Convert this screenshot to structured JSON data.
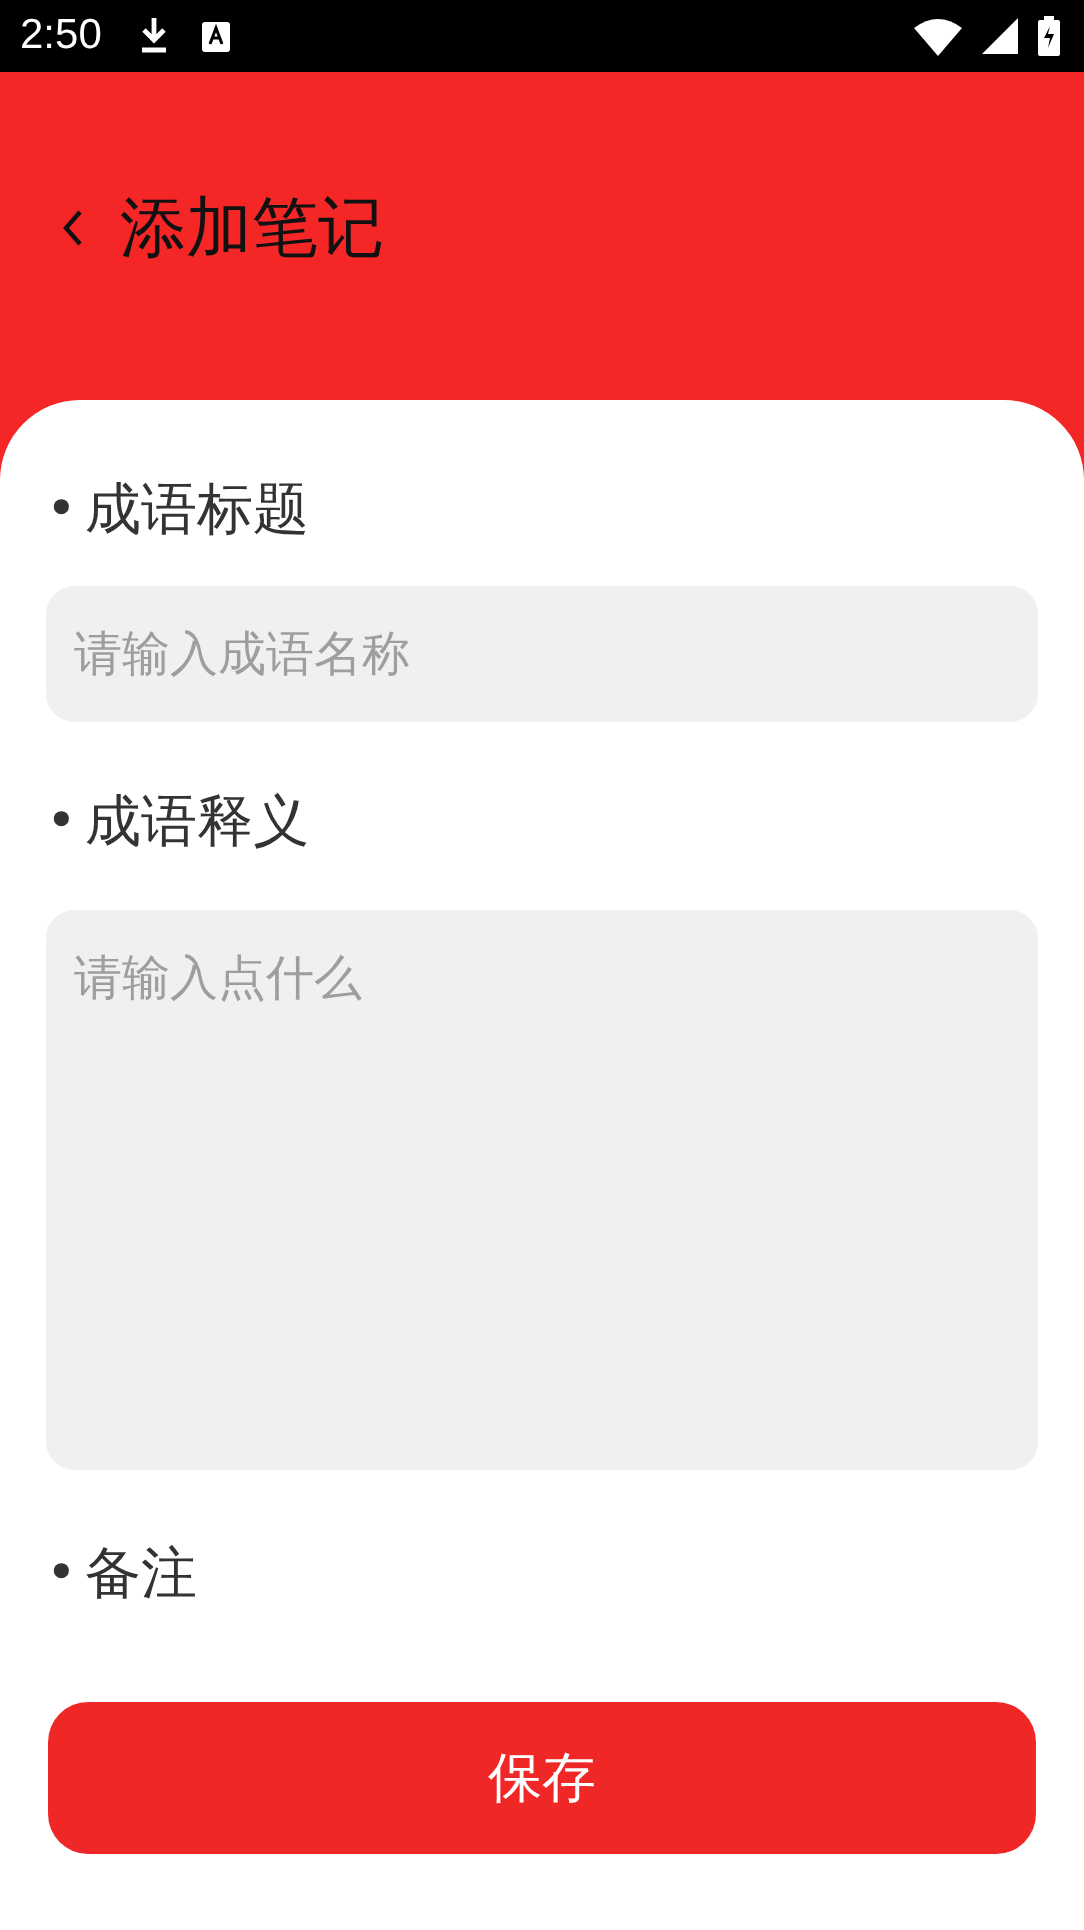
{
  "status_bar": {
    "time": "2:50"
  },
  "header": {
    "title": "添加笔记"
  },
  "sections": [
    {
      "bullet": "•",
      "label": "成语标题",
      "kind": "input",
      "placeholder": "请输入成语名称"
    },
    {
      "bullet": "•",
      "label": "成语释义",
      "kind": "textarea",
      "placeholder": "请输入点什么"
    },
    {
      "bullet": "•",
      "label": "备注",
      "kind": "none"
    }
  ],
  "save_button": "保存"
}
